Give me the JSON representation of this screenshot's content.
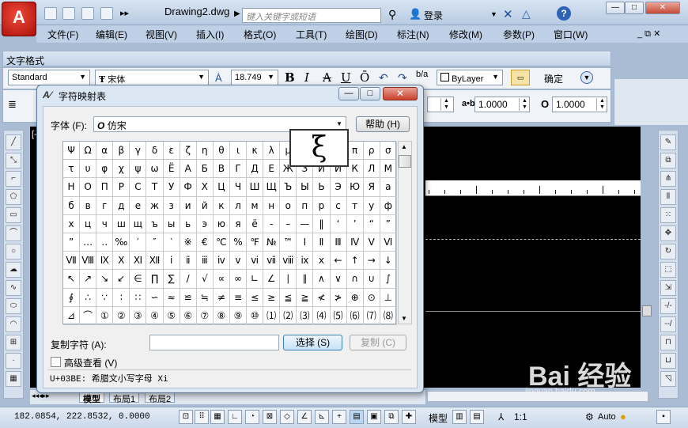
{
  "app": {
    "logo_letter": "A",
    "doc_title": "Drawing2.dwg",
    "search_placeholder": "键入关键字或短语",
    "login": "登录",
    "help": "?"
  },
  "menu": [
    "文件(F)",
    "编辑(E)",
    "视图(V)",
    "插入(I)",
    "格式(O)",
    "工具(T)",
    "绘图(D)",
    "标注(N)",
    "修改(M)",
    "参数(P)",
    "窗口(W)"
  ],
  "text_format": {
    "title": "文字格式",
    "style": "Standard",
    "font": "宋体",
    "height": "18.749",
    "bold": "B",
    "italic": "I",
    "underline": "U",
    "overline": "Ō",
    "color": "ByLayer",
    "ok": "确定",
    "tracking": "1.0000",
    "width": "1.0000",
    "tracking_label": "a•b",
    "width_label": "O"
  },
  "charmap": {
    "title": "字符映射表",
    "font_label": "字体 (F):",
    "font_value": "仿宋",
    "help": "帮助 (H)",
    "preview": "ξ",
    "copy_label": "复制字符 (A):",
    "copy_value": "",
    "select": "选择 (S)",
    "copy": "复制 (C)",
    "advanced": "高级查看 (V)",
    "status": "U+03BE: 希腊文小写字母 Xi",
    "chars": [
      "Ψ",
      "Ω",
      "α",
      "β",
      "γ",
      "δ",
      "ε",
      "ζ",
      "η",
      "θ",
      "ι",
      "κ",
      "λ",
      "μ",
      "ν",
      "ξ",
      "ο",
      "π",
      "ρ",
      "σ",
      "τ",
      "υ",
      "φ",
      "χ",
      "ψ",
      "ω",
      "Ё",
      "А",
      "Б",
      "В",
      "Г",
      "Д",
      "Е",
      "Ж",
      "З",
      "И",
      "Й",
      "К",
      "Л",
      "М",
      "Н",
      "О",
      "П",
      "Р",
      "С",
      "Т",
      "У",
      "Ф",
      "Х",
      "Ц",
      "Ч",
      "Ш",
      "Щ",
      "Ъ",
      "Ы",
      "Ь",
      "Э",
      "Ю",
      "Я",
      "а",
      "б",
      "в",
      "г",
      "д",
      "е",
      "ж",
      "з",
      "и",
      "й",
      "к",
      "л",
      "м",
      "н",
      "о",
      "п",
      "р",
      "с",
      "т",
      "у",
      "ф",
      "х",
      "ц",
      "ч",
      "ш",
      "щ",
      "ъ",
      "ы",
      "ь",
      "э",
      "ю",
      "я",
      "ё",
      "‐",
      "–",
      "—",
      "‖",
      "‘",
      "’",
      "“",
      "”",
      "”",
      "…",
      "‥",
      "‰",
      "′",
      "″",
      "‵",
      "※",
      "€",
      "℃",
      "%",
      "℉",
      "№",
      "™",
      "Ⅰ",
      "Ⅱ",
      "Ⅲ",
      "Ⅳ",
      "Ⅴ",
      "Ⅵ",
      "Ⅶ",
      "Ⅷ",
      "Ⅸ",
      "Ⅹ",
      "Ⅺ",
      "Ⅻ",
      "ⅰ",
      "ⅱ",
      "ⅲ",
      "ⅳ",
      "ⅴ",
      "ⅵ",
      "ⅶ",
      "ⅷ",
      "ⅸ",
      "ⅹ",
      "←",
      "↑",
      "→",
      "↓",
      "↖",
      "↗",
      "↘",
      "↙",
      "∈",
      "∏",
      "∑",
      "∕",
      "√",
      "∝",
      "∞",
      "∟",
      "∠",
      "∣",
      "∥",
      "∧",
      "∨",
      "∩",
      "∪",
      "∫",
      "∮",
      "∴",
      "∵",
      "∶",
      "∷",
      "∽",
      "≈",
      "≌",
      "≒",
      "≠",
      "≡",
      "≤",
      "≥",
      "≦",
      "≧",
      "≮",
      "≯",
      "⊕",
      "⊙",
      "⊥",
      "⊿",
      "⌒",
      "①",
      "②",
      "③",
      "④",
      "⑤",
      "⑥",
      "⑦",
      "⑧",
      "⑨",
      "⑩",
      "⑴",
      "⑵",
      "⑶",
      "⑷",
      "⑸",
      "⑹",
      "⑺",
      "⑻"
    ]
  },
  "layout_tabs": [
    "模型",
    "布局1",
    "布局2"
  ],
  "status": {
    "coords": "182.0854, 222.8532, 0.0000",
    "model": "模型",
    "scale": "1:1",
    "auto": "Auto"
  },
  "watermark": {
    "brand": "Bai 经验",
    "url": "jingyan.baidu.com"
  }
}
